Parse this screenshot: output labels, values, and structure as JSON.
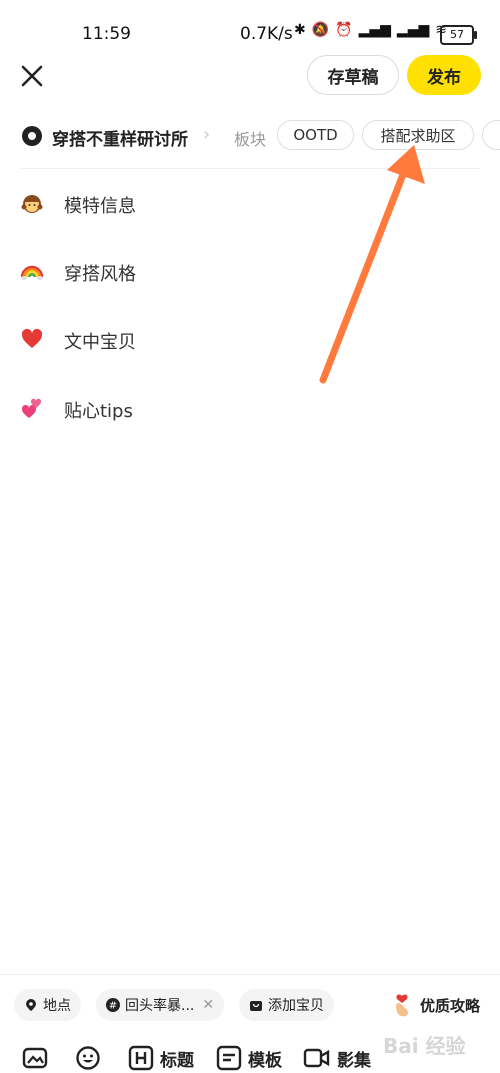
{
  "status_bar": {
    "time": "11:59",
    "network_speed": "0.7K/s",
    "battery": "57"
  },
  "header": {
    "draft_label": "存草稿",
    "publish_label": "发布",
    "accent_color": "#ffe000"
  },
  "topic": {
    "name": "穿搭不重样研讨所",
    "board_label": "板块",
    "chips": [
      "OOTD",
      "搭配求助区"
    ]
  },
  "sections": [
    {
      "icon": "girl-emoji-icon",
      "label": "模特信息"
    },
    {
      "icon": "rainbow-emoji-icon",
      "label": "穿搭风格"
    },
    {
      "icon": "heart-emoji-icon",
      "label": "文中宝贝"
    },
    {
      "icon": "two-hearts-emoji-icon",
      "label": "贴心tips"
    }
  ],
  "bottom_tags": {
    "location": "地点",
    "hashtag": "回头率暴...",
    "add_item": "添加宝贝",
    "guide": "优质攻略"
  },
  "toolbar": {
    "title_label": "标题",
    "template_label": "模板",
    "video_label": "影集"
  },
  "watermark": "Bai 经验"
}
